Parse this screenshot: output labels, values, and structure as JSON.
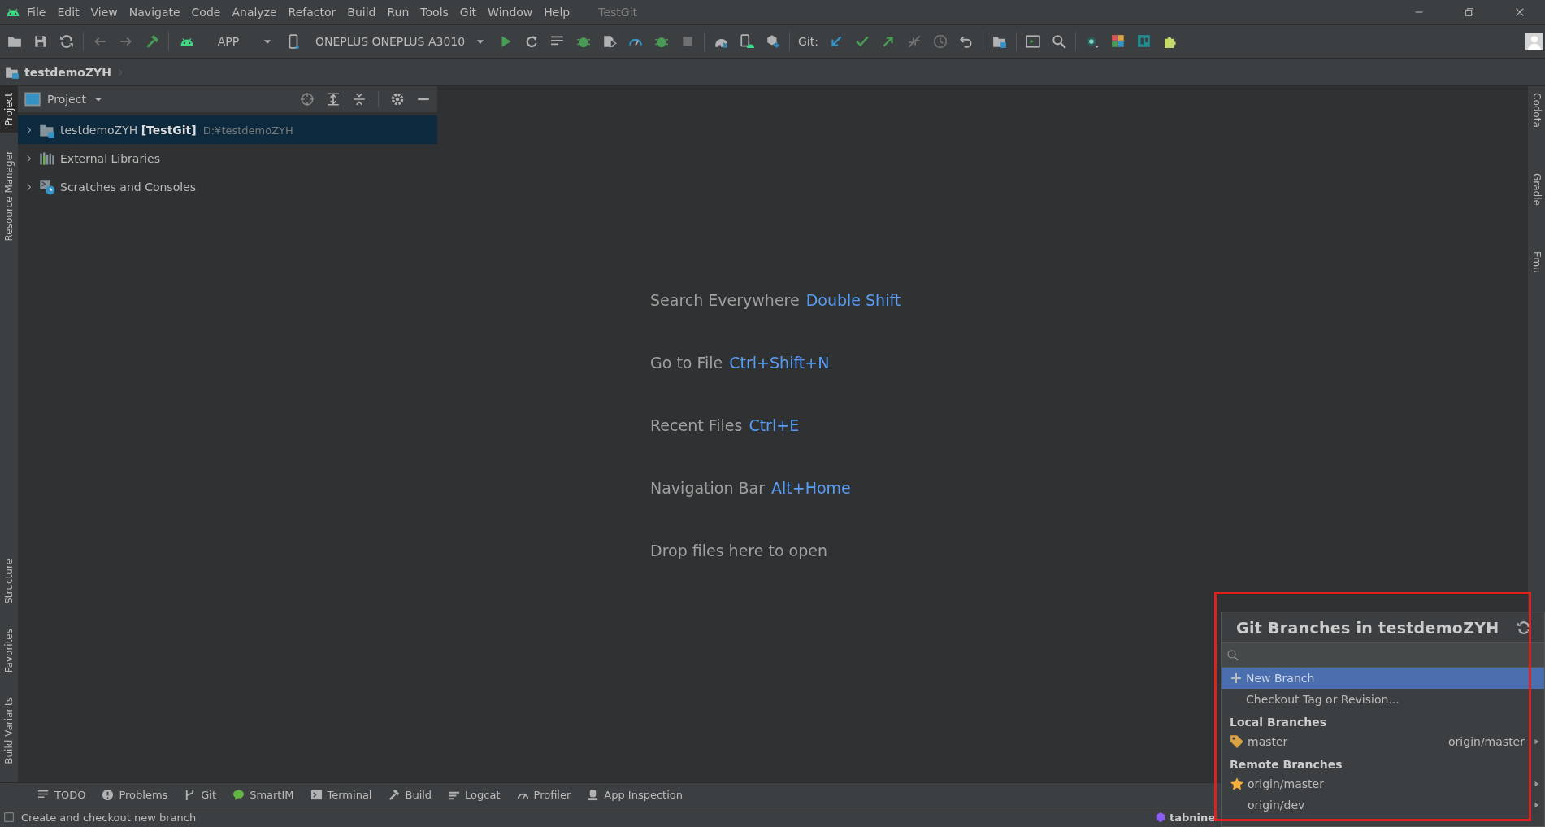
{
  "menu_bar": {
    "items": [
      "File",
      "Edit",
      "View",
      "Navigate",
      "Code",
      "Analyze",
      "Refactor",
      "Build",
      "Run",
      "Tools",
      "Git",
      "Window",
      "Help"
    ],
    "project_title": "TestGit"
  },
  "toolbar": {
    "run_config": "APP",
    "device": "ONEPLUS ONEPLUS A3010",
    "git_label": "Git:"
  },
  "breadcrumb": "testdemoZYH",
  "left_stripe": {
    "top": [
      {
        "label": "Project",
        "selected": true
      },
      {
        "label": "Resource Manager",
        "selected": false
      }
    ],
    "bottom": [
      {
        "label": "Structure",
        "selected": false
      },
      {
        "label": "Favorites",
        "selected": false
      },
      {
        "label": "Build Variants",
        "selected": false
      }
    ]
  },
  "project_panel": {
    "title": "Project",
    "tree": [
      {
        "kind": "project",
        "label": "testdemoZYH",
        "module": "[TestGit]",
        "path": "D:¥testdemoZYH",
        "selected": true,
        "expanded": false
      },
      {
        "kind": "libraries",
        "label": "External Libraries",
        "selected": false,
        "expanded": false
      },
      {
        "kind": "scratches",
        "label": "Scratches and Consoles",
        "selected": false,
        "expanded": false
      }
    ]
  },
  "editor_hints": [
    {
      "action": "Search Everywhere",
      "shortcut": "Double Shift"
    },
    {
      "action": "Go to File",
      "shortcut": "Ctrl+Shift+N"
    },
    {
      "action": "Recent Files",
      "shortcut": "Ctrl+E"
    },
    {
      "action": "Navigation Bar",
      "shortcut": "Alt+Home"
    },
    {
      "action": "Drop files here to open"
    }
  ],
  "right_stripe": [
    {
      "label": "Codota"
    },
    {
      "label": "Gradle"
    },
    {
      "label": "Emu"
    }
  ],
  "bottom_tools": [
    "TODO",
    "Problems",
    "Git",
    "SmartIM",
    "Terminal",
    "Build",
    "Logcat",
    "Profiler",
    "App Inspection"
  ],
  "status_bar": {
    "message": "Create and checkout new branch",
    "plugin": "tabnine"
  },
  "git_branches_popup": {
    "title": "Git Branches in testdemoZYH",
    "actions": [
      {
        "label": "New Branch",
        "selected": true
      },
      {
        "label": "Checkout Tag or Revision...",
        "selected": false
      }
    ],
    "sections": [
      {
        "title": "Local Branches",
        "branches": [
          {
            "kind": "current",
            "name": "master",
            "tracking": "origin/master"
          }
        ]
      },
      {
        "title": "Remote Branches",
        "branches": [
          {
            "kind": "favorite",
            "name": "origin/master"
          },
          {
            "kind": "plain",
            "name": "origin/dev"
          }
        ]
      }
    ]
  }
}
